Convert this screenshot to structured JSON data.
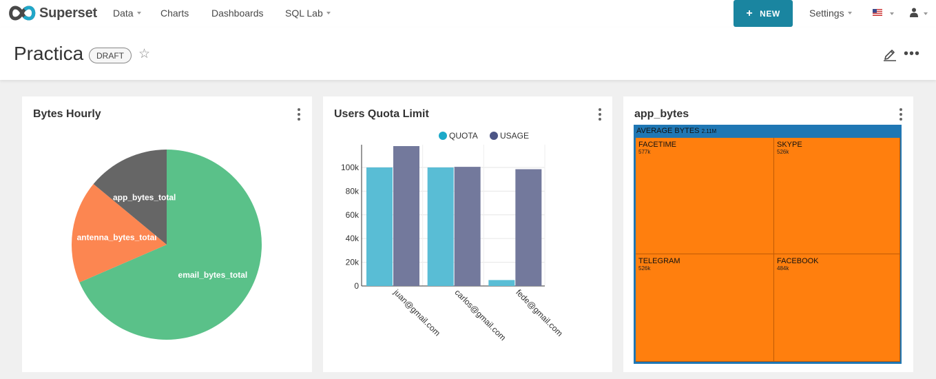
{
  "nav": {
    "brand": "Superset",
    "data_label": "Data",
    "charts_label": "Charts",
    "dashboards_label": "Dashboards",
    "sqllab_label": "SQL Lab",
    "new_label": "NEW",
    "settings_label": "Settings"
  },
  "dashboard": {
    "title": "Practica",
    "status": "DRAFT"
  },
  "charts": {
    "pie": {
      "title": "Bytes Hourly",
      "chart_data": {
        "type": "pie",
        "slices": [
          {
            "label": "email_bytes_total",
            "value": 68.5,
            "color": "#5ac189"
          },
          {
            "label": "antenna_bytes_total",
            "value": 17.5,
            "color": "#fc8651"
          },
          {
            "label": "app_bytes_total",
            "value": 14.0,
            "color": "#666666"
          }
        ]
      }
    },
    "bar": {
      "title": "Users Quota Limit",
      "chart_data": {
        "type": "bar",
        "categories": [
          "juan@gmail.com",
          "carlos@gmail.com",
          "fede@gmail.com"
        ],
        "series": [
          {
            "name": "QUOTA",
            "values": [
              100000,
              100000,
              5000
            ],
            "color": "#59bdd5"
          },
          {
            "name": "USAGE",
            "values": [
              118000,
              100500,
              98500
            ],
            "color": "#73799c"
          }
        ],
        "yticks": [
          "0",
          "20k",
          "40k",
          "60k",
          "80k",
          "100k"
        ],
        "ylim": [
          0,
          118000
        ]
      }
    },
    "treemap": {
      "title": "app_bytes",
      "chart_data": {
        "type": "treemap",
        "root": {
          "label": "AVERAGE BYTES",
          "value": "2.11M"
        },
        "cells": [
          {
            "label": "FACETIME",
            "value": "577k"
          },
          {
            "label": "SKYPE",
            "value": "526k"
          },
          {
            "label": "TELEGRAM",
            "value": "526k"
          },
          {
            "label": "FACEBOOK",
            "value": "484k"
          }
        ]
      }
    }
  }
}
